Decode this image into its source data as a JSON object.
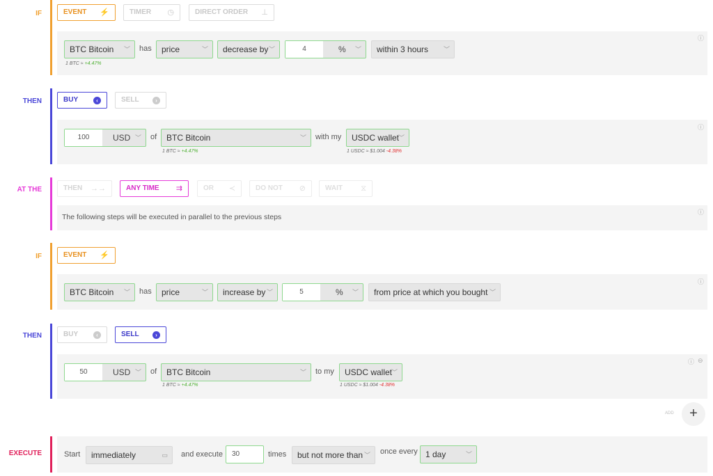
{
  "colors": {
    "if": "#f0a030",
    "then": "#4a47d8",
    "at_the": "#e63ad8",
    "execute": "#e0205a",
    "valid_border": "#8ed88e"
  },
  "s1": {
    "label": "IF",
    "tabs": {
      "event": "EVENT",
      "timer": "TIMER",
      "direct": "DIRECT ORDER"
    },
    "asset": "BTC Bitcoin",
    "has": "has",
    "metric": "price",
    "change": "decrease by",
    "amount": "4",
    "unit": "%",
    "window": "within 3 hours",
    "sub_prefix": "1 BTC ≈",
    "sub_change": "+4.47%"
  },
  "s2": {
    "label": "THEN",
    "tabs": {
      "buy": "BUY",
      "sell": "SELL"
    },
    "amount": "100",
    "currency": "USD",
    "of": "of",
    "asset": "BTC Bitcoin",
    "with": "with my",
    "wallet": "USDC wallet",
    "sub_prefix": "1 BTC ≈",
    "sub_change": "+4.47%",
    "wallet_sub_prefix": "1 USDC ≈ $1.004",
    "wallet_sub_change": "-4.38%"
  },
  "s3": {
    "label": "AT THE",
    "tabs": {
      "then": "THEN",
      "any": "ANY TIME",
      "or": "OR",
      "donot": "DO NOT",
      "wait": "WAIT"
    },
    "description": "The following steps will be executed in parallel to the previous steps"
  },
  "s4": {
    "label": "IF",
    "tabs": {
      "event": "EVENT"
    },
    "asset": "BTC Bitcoin",
    "has": "has",
    "metric": "price",
    "change": "increase by",
    "amount": "5",
    "unit": "%",
    "window": "from price at which you bought"
  },
  "s5": {
    "label": "THEN",
    "tabs": {
      "buy": "BUY",
      "sell": "SELL"
    },
    "amount": "50",
    "currency": "USD",
    "of": "of",
    "asset": "BTC Bitcoin",
    "to": "to my",
    "wallet": "USDC wallet",
    "sub_prefix": "1 BTC ≈",
    "sub_change": "+4.47%",
    "wallet_sub_prefix": "1 USDC ≈ $1.004",
    "wallet_sub_change": "-4.38%"
  },
  "add": {
    "label": "ADD",
    "symbol": "+"
  },
  "exec": {
    "label": "EXECUTE",
    "start": "Start",
    "when": "immediately",
    "and_execute": "and execute",
    "times_value": "30",
    "times": "times",
    "limit": "but not more than",
    "once_every": "once every",
    "interval": "1 day"
  }
}
